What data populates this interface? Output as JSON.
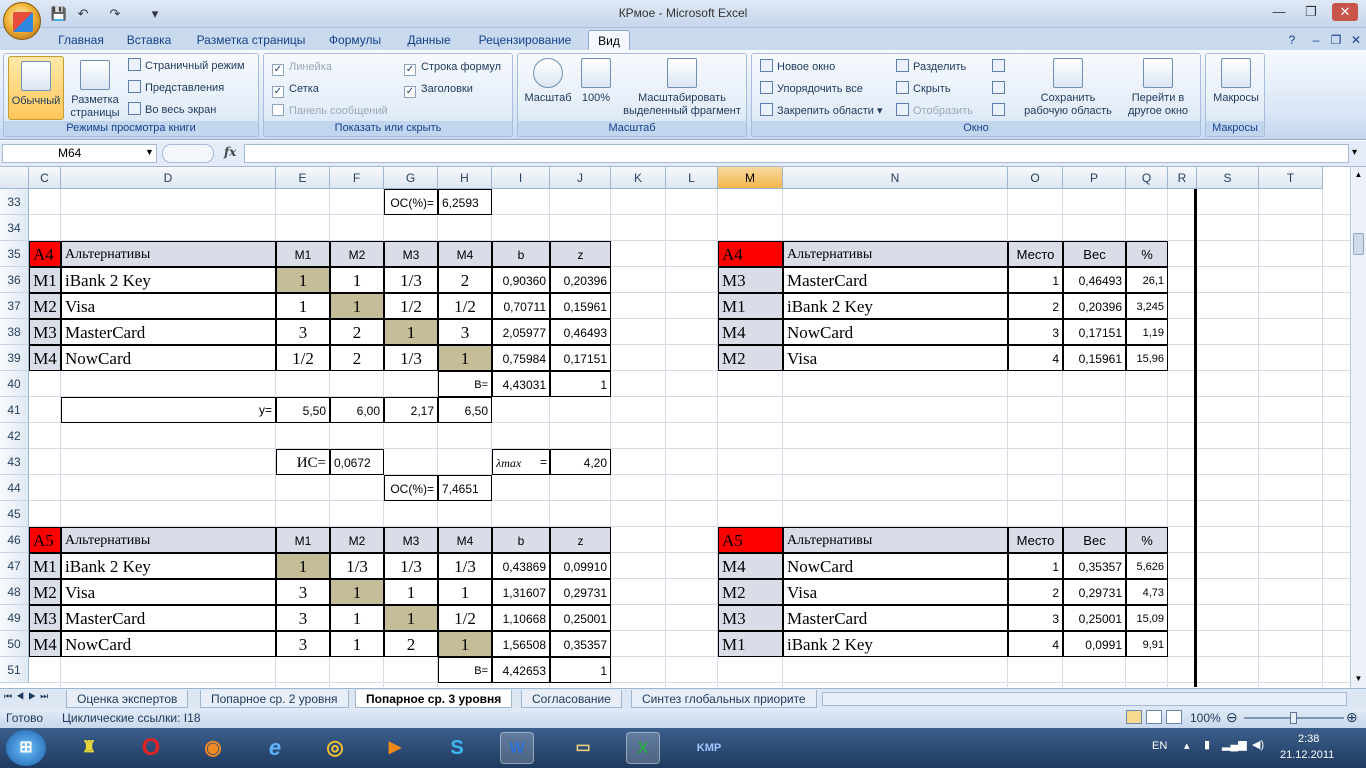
{
  "app": {
    "title": "КРмое - Microsoft Excel"
  },
  "ribbon_tabs": [
    "Главная",
    "Вставка",
    "Разметка страницы",
    "Формулы",
    "Данные",
    "Рецензирование",
    "Вид"
  ],
  "ribbon": {
    "g1": {
      "label": "Режимы просмотра книги",
      "normal": "Обычный",
      "page_layout": "Разметка страницы",
      "page_break": "Страничный режим",
      "views": "Представления",
      "fullscreen": "Во весь экран"
    },
    "g2": {
      "label": "Показать или скрыть",
      "ruler": "Линейка",
      "gridlines": "Сетка",
      "msgbar": "Панель сообщений",
      "formula_bar": "Строка формул",
      "headings": "Заголовки"
    },
    "g3": {
      "label": "Масштаб",
      "zoom": "Масштаб",
      "zoom100": "100%",
      "zoom_sel": "Масштабировать выделенный фрагмент"
    },
    "g4": {
      "label": "Окно",
      "new_window": "Новое окно",
      "arrange": "Упорядочить все",
      "freeze": "Закрепить области",
      "split": "Разделить",
      "hide": "Скрыть",
      "unhide": "Отобразить",
      "save_ws": "Сохранить рабочую область",
      "switch": "Перейти в другое окно"
    },
    "g5": {
      "label": "Макросы",
      "macros": "Макросы"
    }
  },
  "formula_bar": {
    "namebox": "M64",
    "fx": "fx"
  },
  "grid": {
    "cols": [
      "C",
      "D",
      "E",
      "F",
      "G",
      "H",
      "I",
      "J",
      "K",
      "L",
      "M",
      "N",
      "O",
      "P",
      "Q",
      "R",
      "S",
      "T"
    ],
    "rows": [
      "33",
      "34",
      "35",
      "36",
      "37",
      "38",
      "39",
      "40",
      "41",
      "42",
      "43",
      "44",
      "45",
      "46",
      "47",
      "48",
      "49",
      "50",
      "51"
    ],
    "oc1": "ОС(%)=",
    "oc1v": "6,2593",
    "t1": {
      "a": "A4",
      "h": [
        "Альтернативы",
        "M1",
        "M2",
        "M3",
        "M4",
        "b",
        "z"
      ],
      "r": [
        [
          "M1",
          "iBank 2 Key",
          "1",
          "1",
          "1/3",
          "2",
          "0,90360",
          "0,20396"
        ],
        [
          "M2",
          "Visa",
          "1",
          "1",
          "1/2",
          "1/2",
          "0,70711",
          "0,15961"
        ],
        [
          "M3",
          "MasterCard",
          "3",
          "2",
          "1",
          "3",
          "2,05977",
          "0,46493"
        ],
        [
          "M4",
          "NowCard",
          "1/2",
          "2",
          "1/3",
          "1",
          "0,75984",
          "0,17151"
        ]
      ],
      "B": "B=",
      "Bv": "4,43031",
      "zsum": "1",
      "y": "y=",
      "yv": [
        "5,50",
        "6,00",
        "2,17",
        "6,50"
      ],
      "ic": "ИС=",
      "icv": "0,0672",
      "lam": "λmax",
      "eq": "=",
      "lamv": "4,20",
      "oc": "ОС(%)=",
      "ocv": "7,4651"
    },
    "r1": {
      "a": "A4",
      "h": [
        "Альтернативы",
        "Место",
        "Вес",
        "%"
      ],
      "r": [
        [
          "M3",
          "MasterCard",
          "1",
          "0,46493",
          "26,1"
        ],
        [
          "M1",
          "iBank 2 Key",
          "2",
          "0,20396",
          "3,245"
        ],
        [
          "M4",
          "NowCard",
          "3",
          "0,17151",
          "1,19"
        ],
        [
          "M2",
          "Visa",
          "4",
          "0,15961",
          "15,96"
        ]
      ]
    },
    "t2": {
      "a": "A5",
      "h": [
        "Альтернативы",
        "M1",
        "M2",
        "M3",
        "M4",
        "b",
        "z"
      ],
      "r": [
        [
          "M1",
          "iBank 2 Key",
          "1",
          "1/3",
          "1/3",
          "1/3",
          "0,43869",
          "0,09910"
        ],
        [
          "M2",
          "Visa",
          "3",
          "1",
          "1",
          "1",
          "1,31607",
          "0,29731"
        ],
        [
          "M3",
          "MasterCard",
          "3",
          "1",
          "1",
          "1/2",
          "1,10668",
          "0,25001"
        ],
        [
          "M4",
          "NowCard",
          "3",
          "1",
          "2",
          "1",
          "1,56508",
          "0,35357"
        ]
      ],
      "B": "B=",
      "Bv": "4,42653",
      "zsum": "1"
    },
    "r2": {
      "a": "A5",
      "h": [
        "Альтернативы",
        "Место",
        "Вес",
        "%"
      ],
      "r": [
        [
          "M4",
          "NowCard",
          "1",
          "0,35357",
          "5,626"
        ],
        [
          "M2",
          "Visa",
          "2",
          "0,29731",
          "4,73"
        ],
        [
          "M3",
          "MasterCard",
          "3",
          "0,25001",
          "15,09"
        ],
        [
          "M1",
          "iBank 2 Key",
          "4",
          "0,0991",
          "9,91"
        ]
      ]
    }
  },
  "sheets": [
    "Оценка экспертов",
    "Попарное ср. 2 уровня",
    "Попарное ср. 3 уровня",
    "Согласование",
    "Синтез глобальных приорите"
  ],
  "status": {
    "ready": "Готово",
    "circ": "Циклические ссылки: I18",
    "zoom": "100%"
  },
  "tray": {
    "lang": "EN",
    "time": "2:38",
    "date": "21.12.2011"
  }
}
